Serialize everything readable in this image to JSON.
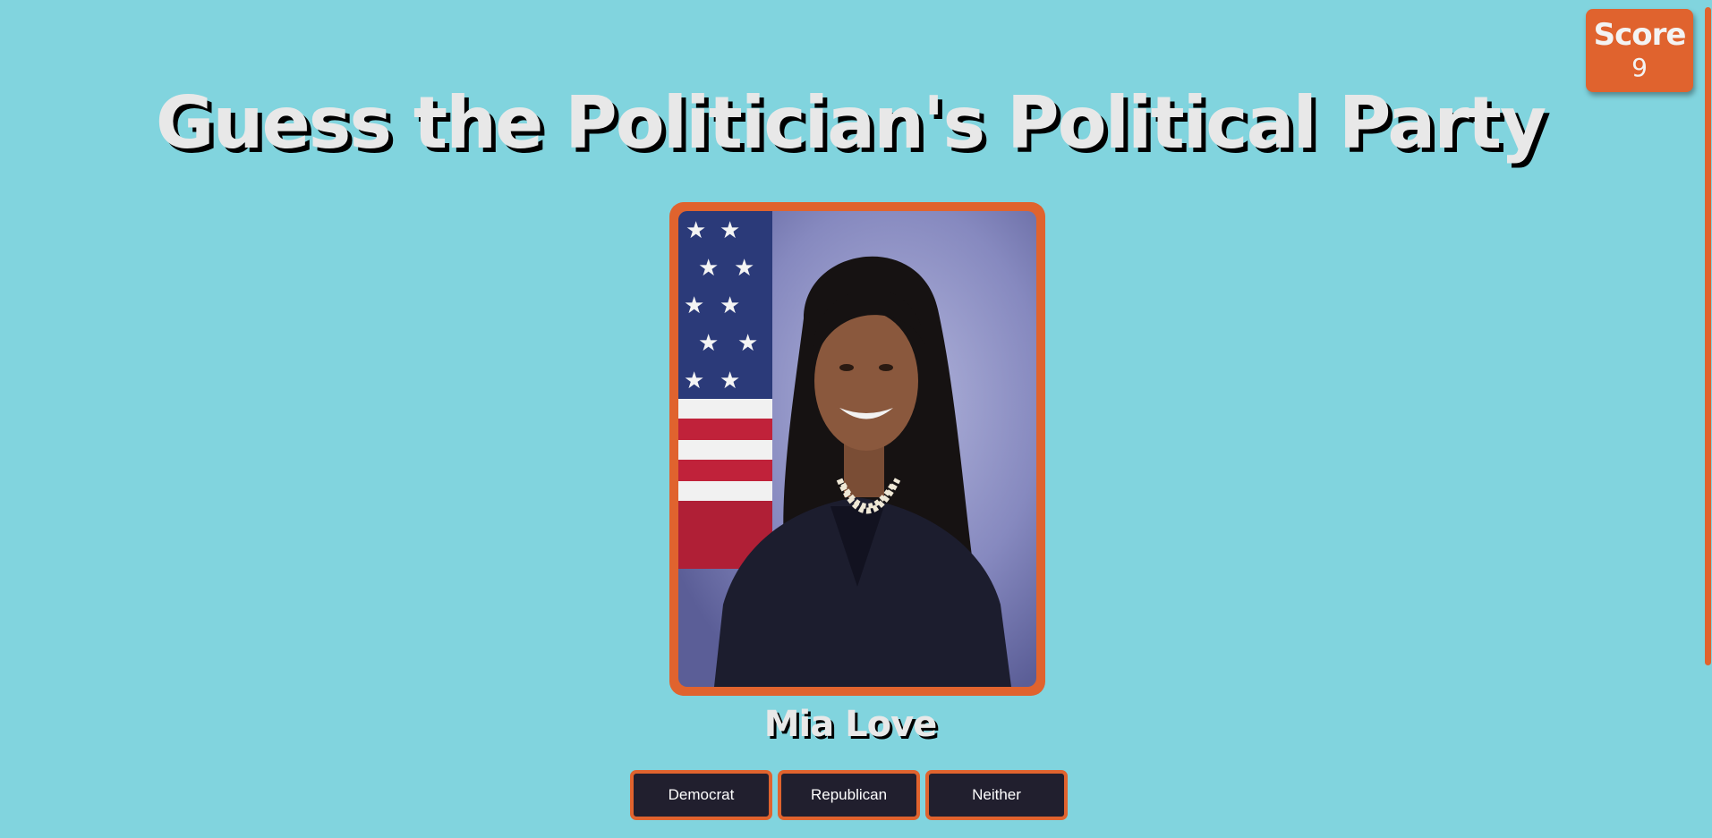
{
  "score": {
    "label": "Score",
    "value": "9"
  },
  "title": "Guess the Politician's Political Party",
  "politician": {
    "name": "Mia Love"
  },
  "choices": [
    {
      "label": "Democrat"
    },
    {
      "label": "Republican"
    },
    {
      "label": "Neither"
    }
  ],
  "colors": {
    "background": "#81d4de",
    "accent": "#e0632e",
    "button": "#211f2e",
    "title_text": "#e8e8e8"
  }
}
